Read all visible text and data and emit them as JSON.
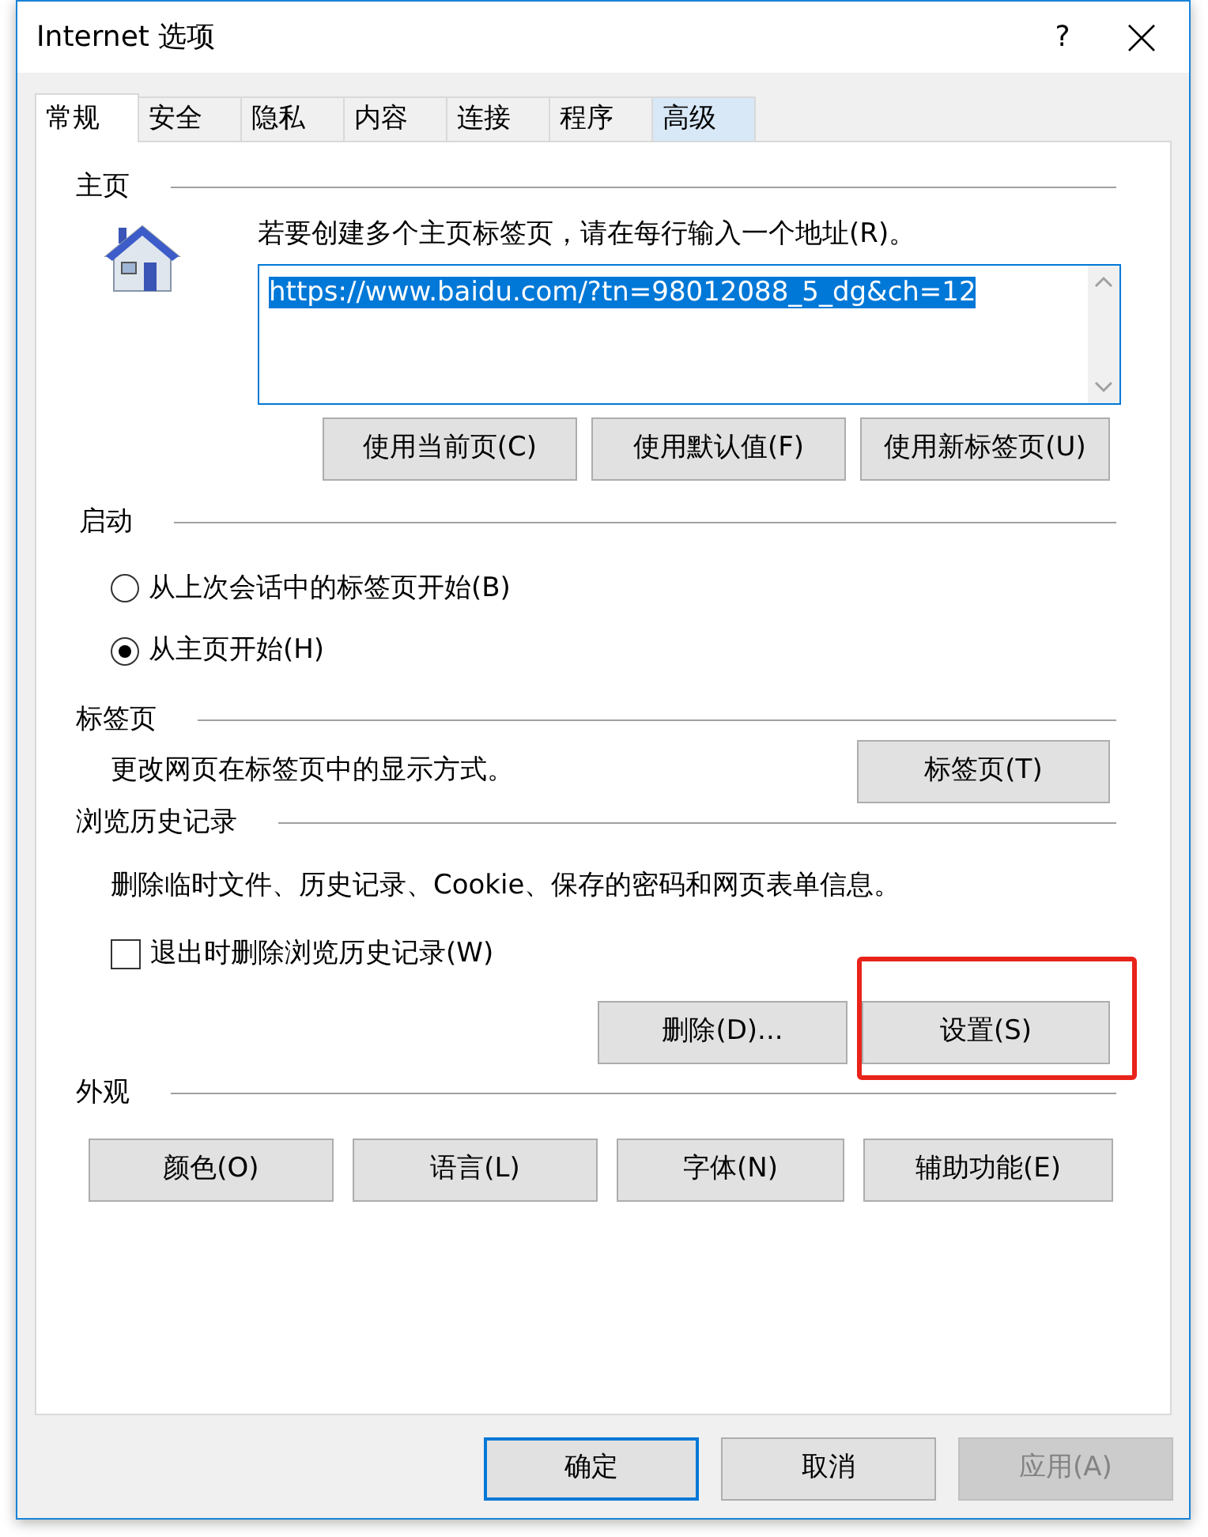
{
  "window": {
    "title": "Internet 选项",
    "help": "?"
  },
  "tabs": [
    {
      "label": "常规",
      "selected": true
    },
    {
      "label": "安全",
      "selected": false
    },
    {
      "label": "隐私",
      "selected": false
    },
    {
      "label": "内容",
      "selected": false
    },
    {
      "label": "连接",
      "selected": false
    },
    {
      "label": "程序",
      "selected": false
    },
    {
      "label": "高级",
      "selected": false
    }
  ],
  "home": {
    "heading": "主页",
    "prompt": "若要创建多个主页标签页，请在每行输入一个地址(R)。",
    "address": "https://www.baidu.com/?tn=98012088_5_dg&ch=12",
    "address_selected": true,
    "buttons": [
      {
        "label": "使用当前页(C)"
      },
      {
        "label": "使用默认值(F)"
      },
      {
        "label": "使用新标签页(U)"
      }
    ]
  },
  "startup": {
    "heading": "启动",
    "options": [
      {
        "label": "从上次会话中的标签页开始(B)",
        "selected": false
      },
      {
        "label": "从主页开始(H)",
        "selected": true
      }
    ]
  },
  "tab_settings": {
    "heading": "标签页",
    "description": "更改网页在标签页中的显示方式。",
    "button": "标签页(T)"
  },
  "history": {
    "heading": "浏览历史记录",
    "description": "删除临时文件、历史记录、Cookie、保存的密码和网页表单信息。",
    "checkbox": {
      "label": "退出时删除浏览历史记录(W)",
      "checked": false
    },
    "buttons": [
      {
        "label": "删除(D)...",
        "highlighted": false
      },
      {
        "label": "设置(S)",
        "highlighted": true
      }
    ]
  },
  "appearance": {
    "heading": "外观",
    "buttons": [
      {
        "label": "颜色(O)"
      },
      {
        "label": "语言(L)"
      },
      {
        "label": "字体(N)"
      },
      {
        "label": "辅助功能(E)"
      }
    ]
  },
  "footer_buttons": [
    {
      "label": "确定",
      "default": true,
      "disabled": false
    },
    {
      "label": "取消",
      "default": false,
      "disabled": false
    },
    {
      "label": "应用(A)",
      "default": false,
      "disabled": true
    }
  ]
}
